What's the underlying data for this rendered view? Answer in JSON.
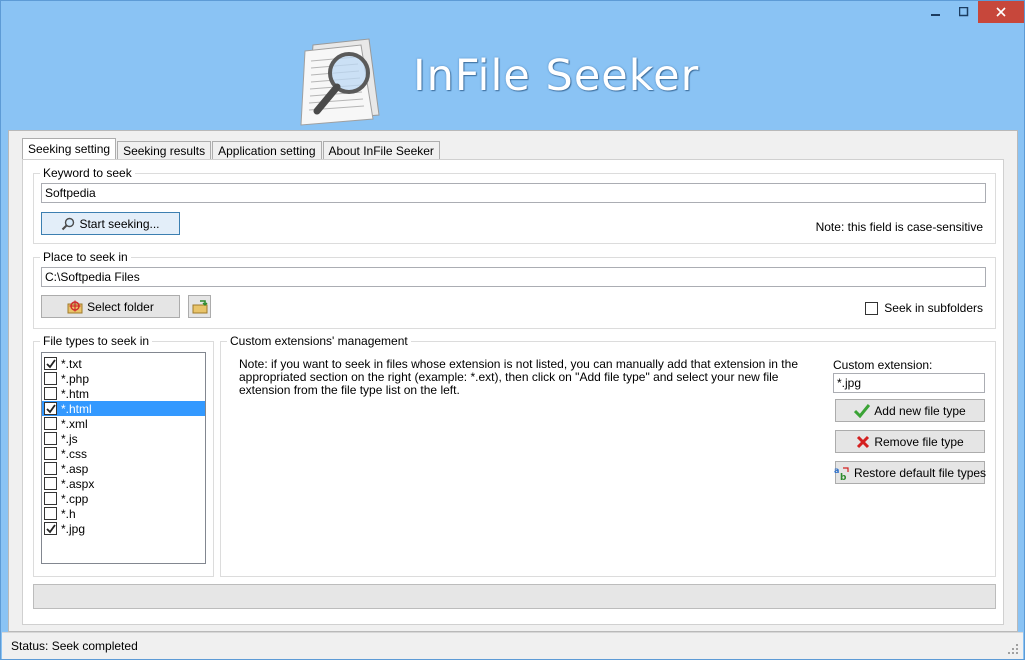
{
  "app": {
    "title": "InFile Seeker"
  },
  "tabs": [
    {
      "label": "Seeking setting"
    },
    {
      "label": "Seeking results"
    },
    {
      "label": "Application setting"
    },
    {
      "label": "About InFile Seeker"
    }
  ],
  "keyword": {
    "group_label": "Keyword to seek",
    "value": "Softpedia",
    "start_button": "Start seeking...",
    "note": "Note: this field is case-sensitive"
  },
  "place": {
    "group_label": "Place to seek in",
    "value": "C:\\Softpedia Files",
    "select_button": "Select folder",
    "subfolders_label": "Seek in subfolders",
    "subfolders_checked": false
  },
  "file_types": {
    "group_label": "File types to seek in",
    "items": [
      {
        "label": "*.txt",
        "checked": true,
        "selected": false
      },
      {
        "label": "*.php",
        "checked": false,
        "selected": false
      },
      {
        "label": "*.htm",
        "checked": false,
        "selected": false
      },
      {
        "label": "*.html",
        "checked": true,
        "selected": true
      },
      {
        "label": "*.xml",
        "checked": false,
        "selected": false
      },
      {
        "label": "*.js",
        "checked": false,
        "selected": false
      },
      {
        "label": "*.css",
        "checked": false,
        "selected": false
      },
      {
        "label": "*.asp",
        "checked": false,
        "selected": false
      },
      {
        "label": "*.aspx",
        "checked": false,
        "selected": false
      },
      {
        "label": "*.cpp",
        "checked": false,
        "selected": false
      },
      {
        "label": "*.h",
        "checked": false,
        "selected": false
      },
      {
        "label": "*.jpg",
        "checked": true,
        "selected": false
      }
    ]
  },
  "custom": {
    "group_label": "Custom extensions' management",
    "note": "Note: if you want to seek in files whose extension is not listed, you can manually add that extension in the appropriated section on the right (example: *.ext), then click on \"Add file type\" and select your new file extension from the file type list on the left.",
    "ext_label": "Custom extension:",
    "ext_value": "*.jpg",
    "add_button": "Add new file type",
    "remove_button": "Remove file type",
    "restore_button": "Restore default file types"
  },
  "status": {
    "text": "Status: Seek completed"
  },
  "colors": {
    "window_bg": "#8ac3f4",
    "selection": "#3399ff",
    "close_button": "#c7473b"
  }
}
